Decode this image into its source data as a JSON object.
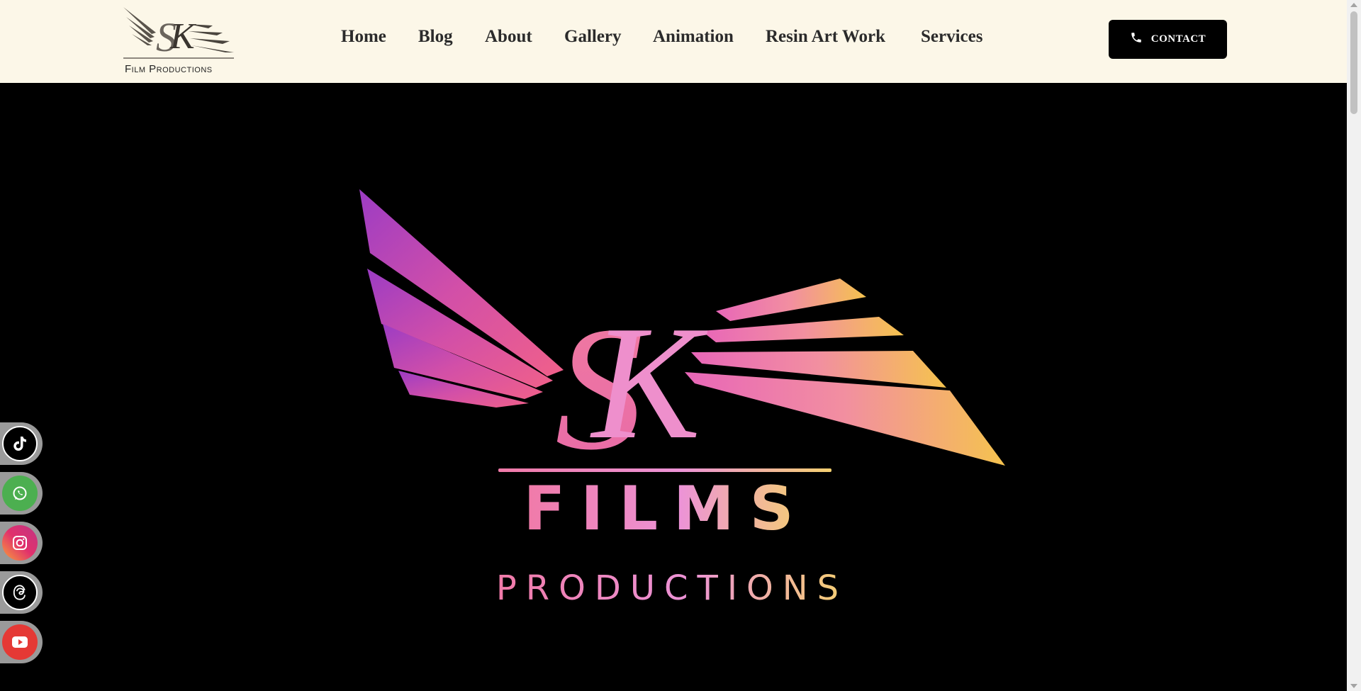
{
  "header": {
    "logo_text": "Film Productions",
    "nav": [
      {
        "label": "Home"
      },
      {
        "label": "Blog"
      },
      {
        "label": "About"
      },
      {
        "label": "Gallery"
      },
      {
        "label": "Animation"
      },
      {
        "label": "Resin Art Work"
      },
      {
        "label": "Services"
      }
    ],
    "contact_label": "CONTACT",
    "contact_icon": "phone-icon"
  },
  "hero": {
    "title": "FILMS",
    "subtitle": "PRODUCTIONS",
    "monogram": "SK"
  },
  "social": [
    {
      "name": "tiktok",
      "icon": "tiktok-icon",
      "color": "#000000"
    },
    {
      "name": "whatsapp",
      "icon": "whatsapp-icon",
      "color": "#4caf50"
    },
    {
      "name": "instagram",
      "icon": "instagram-icon",
      "color": "#e1306c"
    },
    {
      "name": "threads",
      "icon": "threads-icon",
      "color": "#000000"
    },
    {
      "name": "youtube",
      "icon": "youtube-icon",
      "color": "#e53935"
    }
  ],
  "colors": {
    "header_bg": "#fcf7e8",
    "nav_text": "#2b2b2b",
    "hero_bg": "#000000"
  }
}
